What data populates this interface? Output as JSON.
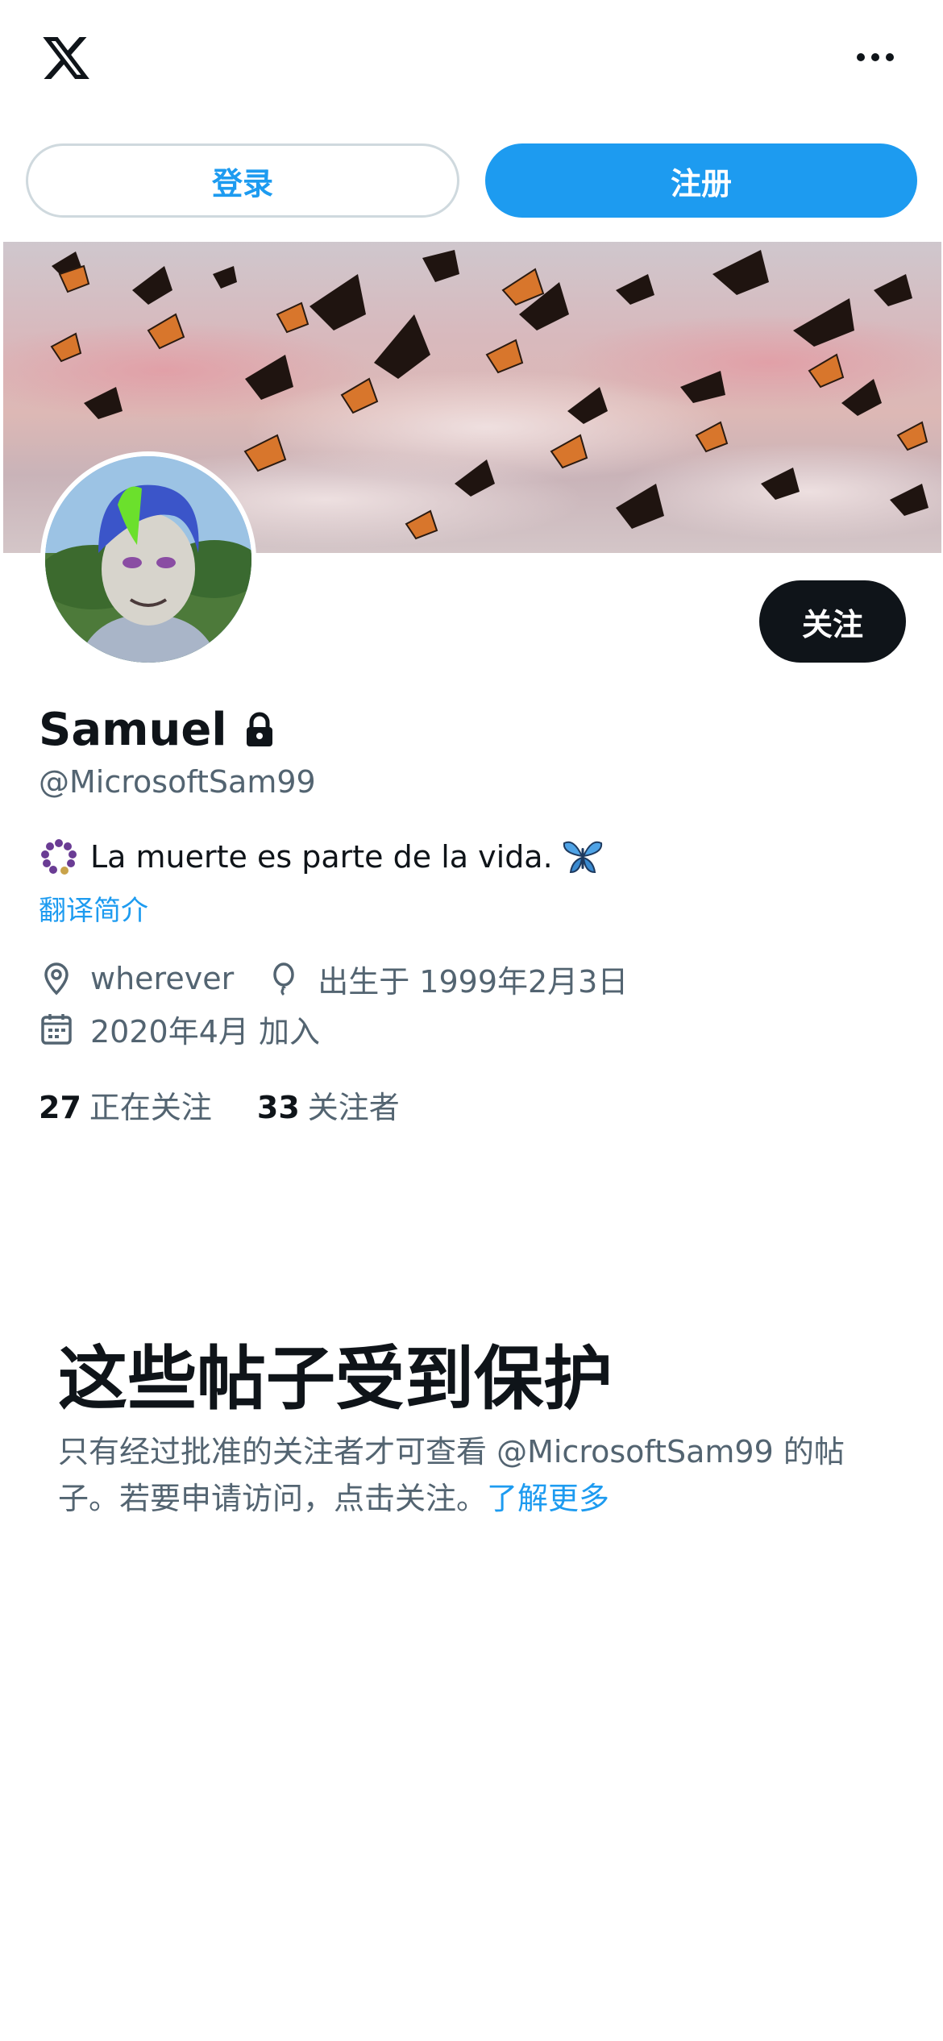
{
  "header": {
    "logo_icon": "x-logo-icon",
    "more_icon": "more-horizontal-icon"
  },
  "auth": {
    "login_label": "登录",
    "signup_label": "注册"
  },
  "profile": {
    "follow_label": "关注",
    "display_name": "Samuel",
    "protected_icon": "lock-icon",
    "handle": "@MicrosoftSam99",
    "bio_leading_emoji": "prayer-beads-emoji",
    "bio_text": "La muerte es parte de la vida.",
    "bio_trailing_emoji": "butterfly-emoji",
    "translate_label": "翻译简介",
    "location_icon": "location-pin-icon",
    "location": "wherever",
    "birthday_icon": "balloon-icon",
    "birthday": "出生于 1999年2月3日",
    "joined_icon": "calendar-icon",
    "joined": "2020年4月 加入",
    "following_count": "27",
    "following_label": "正在关注",
    "followers_count": "33",
    "followers_label": "关注者"
  },
  "protected": {
    "title": "这些帖子受到保护",
    "description": "只有经过批准的关注者才可查看 @MicrosoftSam99 的帖子。若要申请访问，点击关注。",
    "learn_more": "了解更多"
  },
  "colors": {
    "accent": "#1d9bf0",
    "text_primary": "#0f1419",
    "text_secondary": "#536471",
    "border": "#cfd9de"
  }
}
